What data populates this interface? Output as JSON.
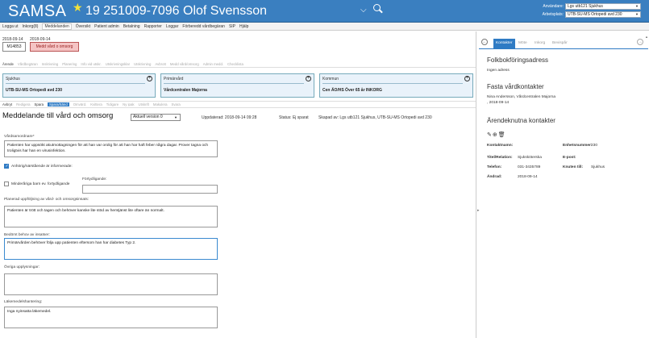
{
  "header": {
    "logo": "SAMSA",
    "patient": "19 251009-7096 Olof Svensson",
    "user_label": "Användare:",
    "user_value": "Lgs utb121 Sjukhus",
    "workplace_label": "Arbetsplats:",
    "workplace_value": "UTB-SU-MS Ortopedi avd 230"
  },
  "menu": [
    "Logga ut",
    "Inkorg(8)",
    "Meddelanden",
    "Översikt",
    "Patient admin",
    "Betalning",
    "Rapporter",
    "Loggar",
    "Förberedd vårdbegäran",
    "SIP",
    "Hjälp"
  ],
  "encounter": {
    "date1": "2018-09-14",
    "date2": "2018-09-14",
    "id": "M14853",
    "status_button": "Medd vård o omsorg"
  },
  "subtabs": [
    "Ärende",
    "Vårdbegäran",
    "Inskrivning",
    "Planering",
    "Info vid utskr.",
    "Utskrivningsklar",
    "Utskrivning",
    "Avbrott",
    "Medd vård/omsorg",
    "Admin medd.",
    "Checklista"
  ],
  "orgs": [
    {
      "title": "Sjukhus",
      "value": "UTB-SU-MS Ortopedi avd 230"
    },
    {
      "title": "Primärvård",
      "value": "Vårdcentralen Majorna"
    },
    {
      "title": "Kommun",
      "value": "Cen ÄO/HS Över 65 år INKORG"
    }
  ],
  "toolbar": [
    "Avbryt",
    "Redigera",
    "Spara",
    "Spara/Sänd",
    "Omvärd.",
    "Kvittera",
    "Tidigare",
    "Ny ipak",
    "Utskrift",
    "Makulera",
    "Svara"
  ],
  "doc": {
    "title": "Meddelande till vård och omsorg",
    "version": "Aktuell version 0",
    "updated": "Uppdaterad: 2018-09-14 09:28",
    "status": "Status: Ej sparat",
    "created_by": "Skapad av: Lgs utb121 Sjukhus, UTB-SU-MS Ortopedi avd 230"
  },
  "form": {
    "reason_label": "Vårdsamordnare",
    "reason_text": "Patienten har uppsökt akutmottagningen för att han var orolig för att han har haft feber några dagar. Prover tagna och troligtvis har han en virusinfektion.",
    "relatives_label": "Anhörig/närstående är informerade:",
    "minors_label": "Minderåriga barn ev. fortydligande",
    "clarify_label": "Förtydligande:",
    "plan_label": "Planerad uppföljning av vård- och omsorgsinsats:",
    "plan_text": "Patienten är trött och tagen och behöver kanske lite stöd av hemtjänst lite oftare än normalt.",
    "needs_label": "Bedömt behov av insatser:",
    "needs_text": "Primärvården behöver följa upp patienten eftersom han har diabetes Typ 2.",
    "other_label": "Övriga upplysningar:",
    "other_text": "",
    "meds_label": "Läkemedelshantering:",
    "meds_text": "Inga nyinsatta läkemedel."
  },
  "right": {
    "tabs": [
      "Kontakter",
      "Möte",
      "Inkorg",
      "Bevispår"
    ],
    "address_heading": "Folkbokföringsadress",
    "address_value": "Ingen adress",
    "contacts_heading": "Fasta vårdkontakter",
    "contact_line1": "Nina Andersson, Vårdcentralen Majorna",
    "contact_line2": ", 2018-09-14",
    "case_heading": "Ärendeknutna kontakter",
    "kontaktnamn_label": "Kontaktnamn:",
    "kontaktnamn_value": "",
    "enhetsnummer_label": "Enhetsnummer:",
    "enhetsnummer_value": "230",
    "titel_label": "Titel/Relation:",
    "titel_value": "Sjuksköterska",
    "epost_label": "E-post:",
    "epost_value": "",
    "telefon_label": "Telefon:",
    "telefon_value": "031-3435789",
    "knuten_label": "Knuten till:",
    "knuten_value": "Sjukhus",
    "andrad_label": "Ändrad:",
    "andrad_value": "2018-09-14"
  },
  "colors": {
    "header": "#3a7fc0",
    "accent": "#2f7bc4",
    "status_red": "#f5c4c4"
  }
}
